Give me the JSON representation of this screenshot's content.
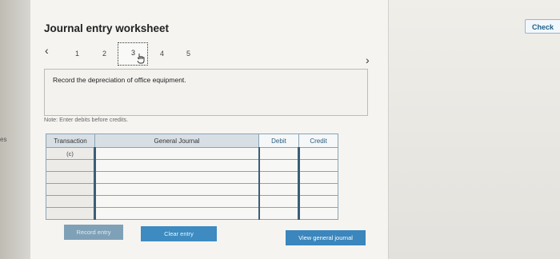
{
  "sidebar": {
    "fragment": "es"
  },
  "header": {
    "title": "Journal entry worksheet",
    "check_label": "Check"
  },
  "nav": {
    "steps": [
      "1",
      "2",
      "3",
      "4",
      "5"
    ],
    "active_step": "3",
    "prev_icon": "chevron-left-icon",
    "next_icon": "chevron-right-icon"
  },
  "prompt": {
    "text": "Record the depreciation of office equipment."
  },
  "note": {
    "text": "Note: Enter debits before credits."
  },
  "table": {
    "headers": {
      "transaction": "Transaction",
      "general_journal": "General Journal",
      "debit": "Debit",
      "credit": "Credit"
    },
    "rows": [
      {
        "transaction": "(c)",
        "account": "",
        "debit": "",
        "credit": ""
      },
      {
        "transaction": "",
        "account": "",
        "debit": "",
        "credit": ""
      },
      {
        "transaction": "",
        "account": "",
        "debit": "",
        "credit": ""
      },
      {
        "transaction": "",
        "account": "",
        "debit": "",
        "credit": ""
      },
      {
        "transaction": "",
        "account": "",
        "debit": "",
        "credit": ""
      },
      {
        "transaction": "",
        "account": "",
        "debit": "",
        "credit": ""
      }
    ]
  },
  "buttons": {
    "record": "Record entry",
    "clear": "Clear entry",
    "view": "View general journal"
  }
}
